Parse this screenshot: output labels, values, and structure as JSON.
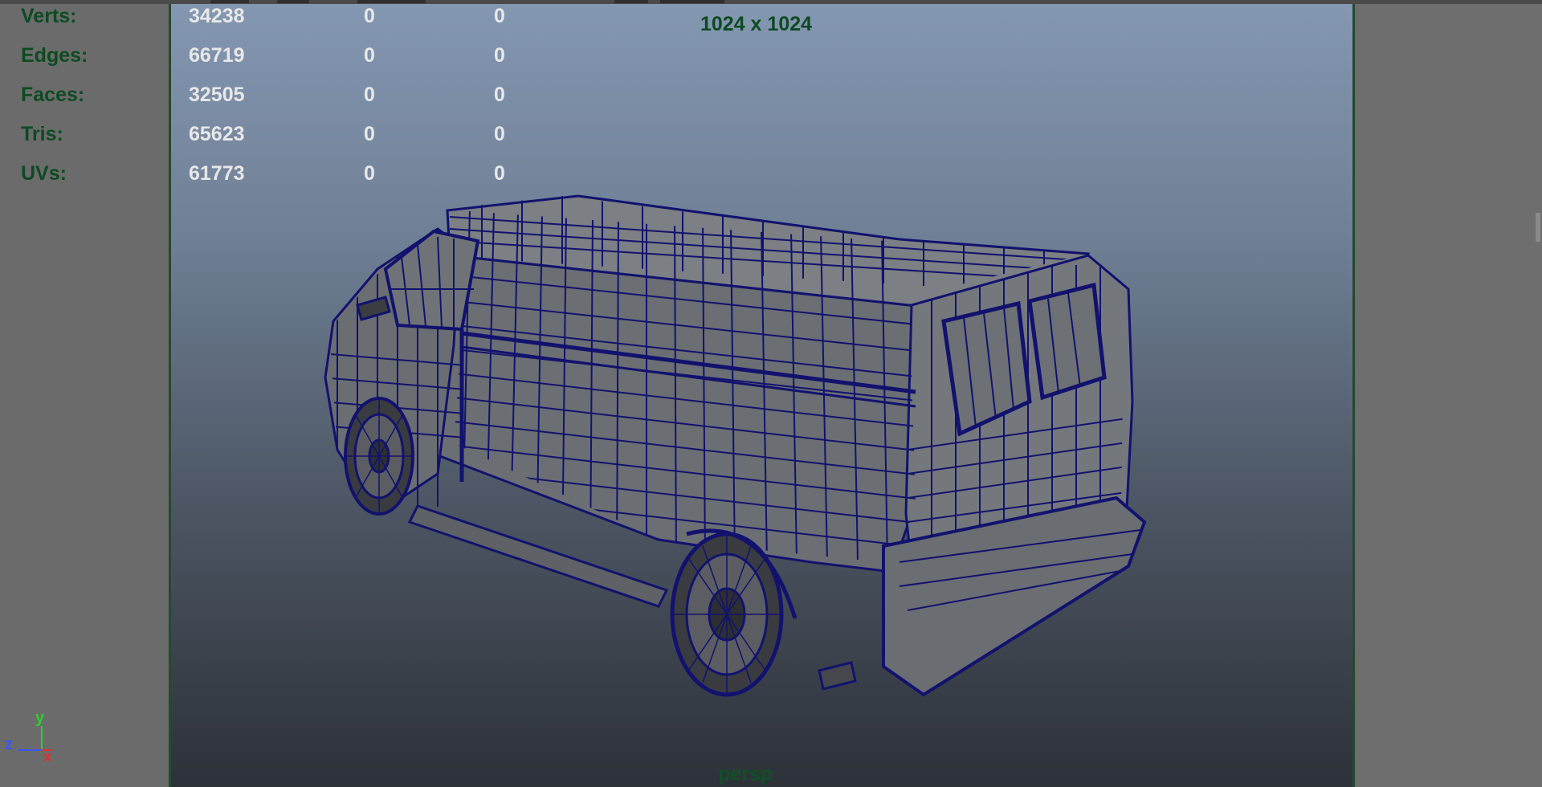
{
  "hud": {
    "rows": [
      {
        "label": "Verts:",
        "v1": "34238",
        "v2": "0",
        "v3": "0"
      },
      {
        "label": "Edges:",
        "v1": "66719",
        "v2": "0",
        "v3": "0"
      },
      {
        "label": "Faces:",
        "v1": "32505",
        "v2": "0",
        "v3": "0"
      },
      {
        "label": "Tris:",
        "v1": "65623",
        "v2": "0",
        "v3": "0"
      },
      {
        "label": "UVs:",
        "v1": "61773",
        "v2": "0",
        "v3": "0"
      }
    ]
  },
  "viewport": {
    "resolution": "1024 x 1024",
    "camera": "persp"
  },
  "axis": {
    "y": "y",
    "z": "z",
    "x": "x"
  },
  "colors": {
    "hud_label": "#0d4a22",
    "wire": "#12126e",
    "axis_y": "#2bd12b",
    "axis_z": "#3a55ff",
    "axis_x": "#e03030"
  }
}
